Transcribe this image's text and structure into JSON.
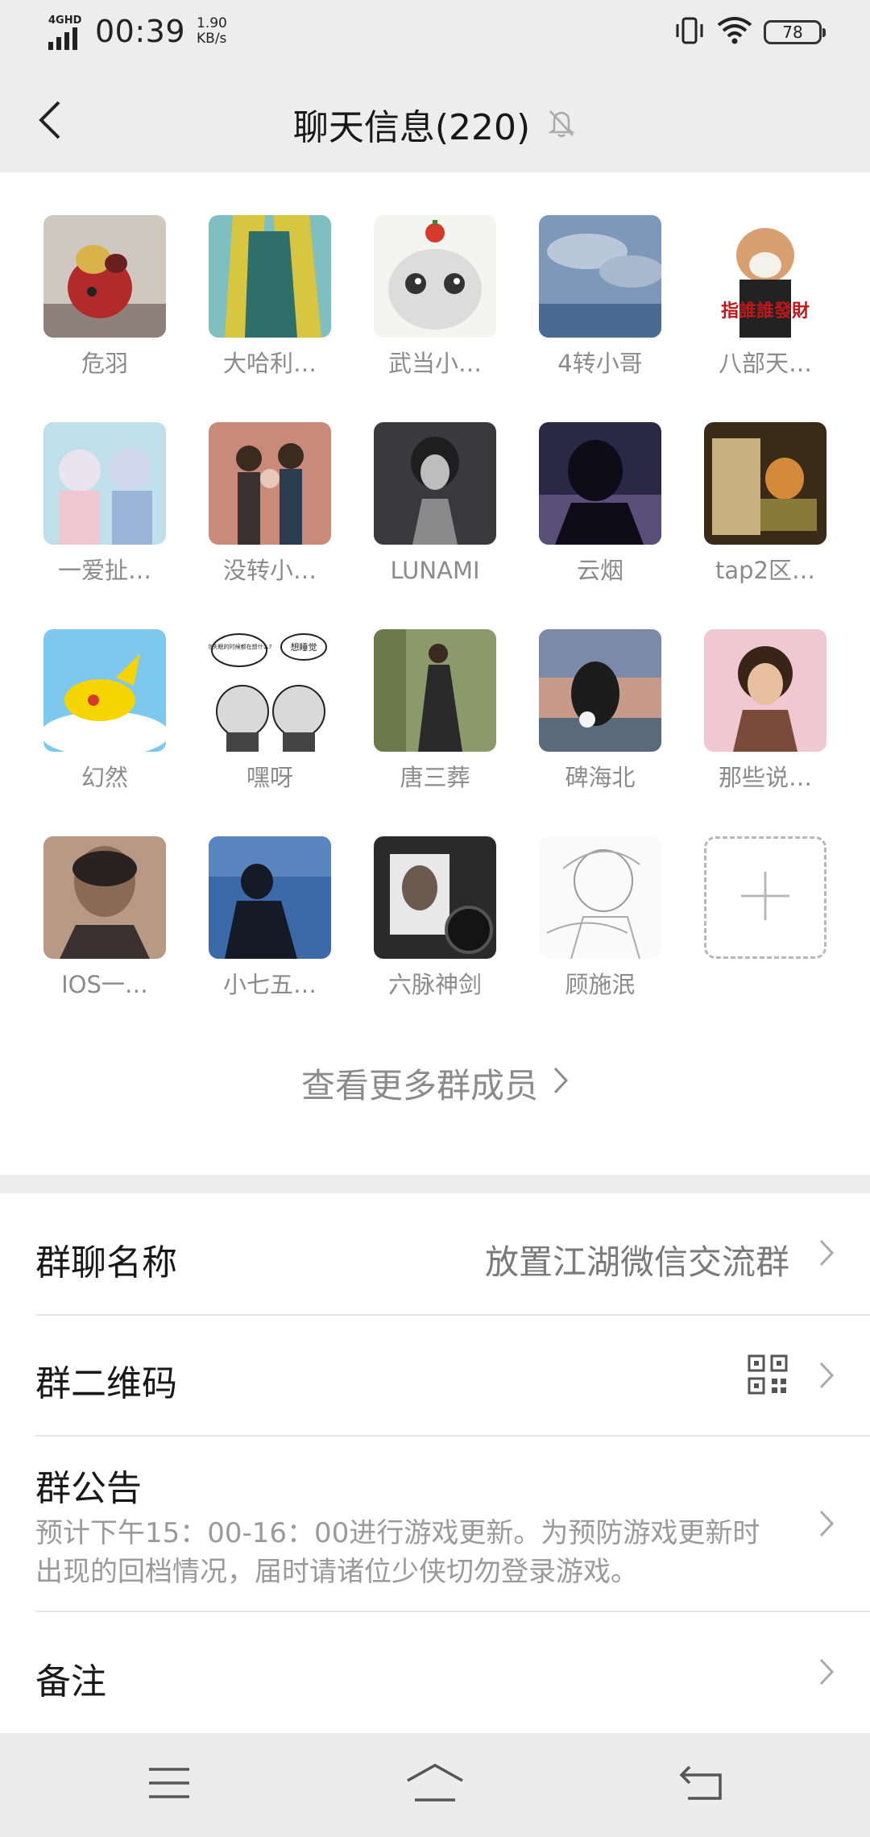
{
  "status_bar": {
    "network": "4GHD",
    "time": "00:39",
    "speed_value": "1.90",
    "speed_unit": "KB/s",
    "battery": "78"
  },
  "header": {
    "title": "聊天信息(220)",
    "back_icon": "chevron-left-icon",
    "mute_icon": "bell-off-icon"
  },
  "members": [
    {
      "name": "危羽"
    },
    {
      "name": "大哈利…"
    },
    {
      "name": "武当小…"
    },
    {
      "name": "4转小哥"
    },
    {
      "name": "八部天…"
    },
    {
      "name": "一爱扯…"
    },
    {
      "name": "没转小…"
    },
    {
      "name": "LUNAMI"
    },
    {
      "name": "云烟"
    },
    {
      "name": "tap2区…"
    },
    {
      "name": "幻然"
    },
    {
      "name": "嘿呀"
    },
    {
      "name": "唐三葬"
    },
    {
      "name": "碑海北"
    },
    {
      "name": "那些说…"
    },
    {
      "name": "IOS一…"
    },
    {
      "name": "小七五…"
    },
    {
      "name": "六脉神剑"
    },
    {
      "name": "顾施泯"
    }
  ],
  "avatar_texts": {
    "cat_banner": "指誰誰發財",
    "meme_left": "你失眠的时候都在想什么?",
    "meme_right": "想睡觉"
  },
  "more_members": "查看更多群成员",
  "settings": {
    "group_name_label": "群聊名称",
    "group_name_value": "放置江湖微信交流群",
    "qr_label": "群二维码",
    "notice_label": "群公告",
    "notice_text": "预计下午15：00-16：00进行游戏更新。为预防游戏更新时出现的回档情况，届时请诸位少侠切勿登录游戏。",
    "remark_label": "备注"
  },
  "colors": {
    "background": "#ededed",
    "panel": "#ffffff",
    "secondary_text": "#8b8b8b"
  }
}
